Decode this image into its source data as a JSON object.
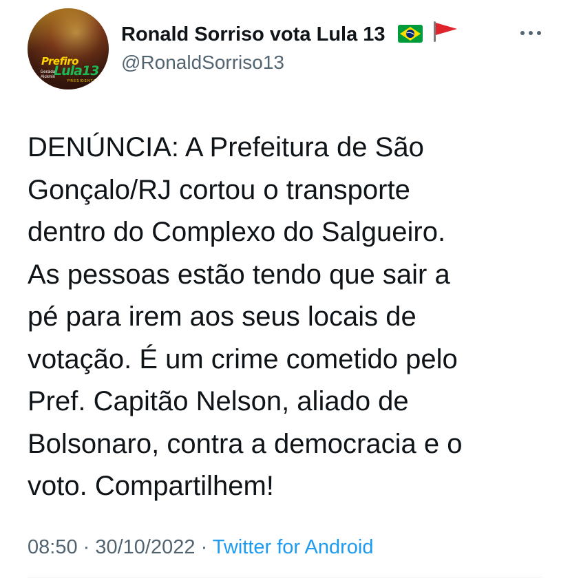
{
  "user": {
    "display_name": "Ronald Sorriso vota Lula 13",
    "handle": "@RonaldSorriso13",
    "avatar_logo": {
      "line1": "Prefiro",
      "line2": "Lula13",
      "line3": "Geraldo Alckmin",
      "line4": "PRESIDENTE"
    },
    "badges": [
      "brazil-flag-icon",
      "red-flag-icon"
    ]
  },
  "tweet": {
    "text": "DENÚNCIA: A Prefeitura de São\nGonçalo/RJ cortou o transporte\ndentro do Complexo do Salgueiro.\nAs pessoas estão tendo que sair a\npé para irem aos seus locais de\nvotação. É um crime cometido pelo\nPref. Capitão Nelson, aliado de\nBolsonaro, contra a democracia e o\nvoto. Compartilhem!",
    "time": "08:50",
    "separator": " · ",
    "date": "30/10/2022",
    "source": "Twitter for Android"
  },
  "colors": {
    "text": "#0f1419",
    "secondary": "#536471",
    "link": "#1d9bf0"
  }
}
